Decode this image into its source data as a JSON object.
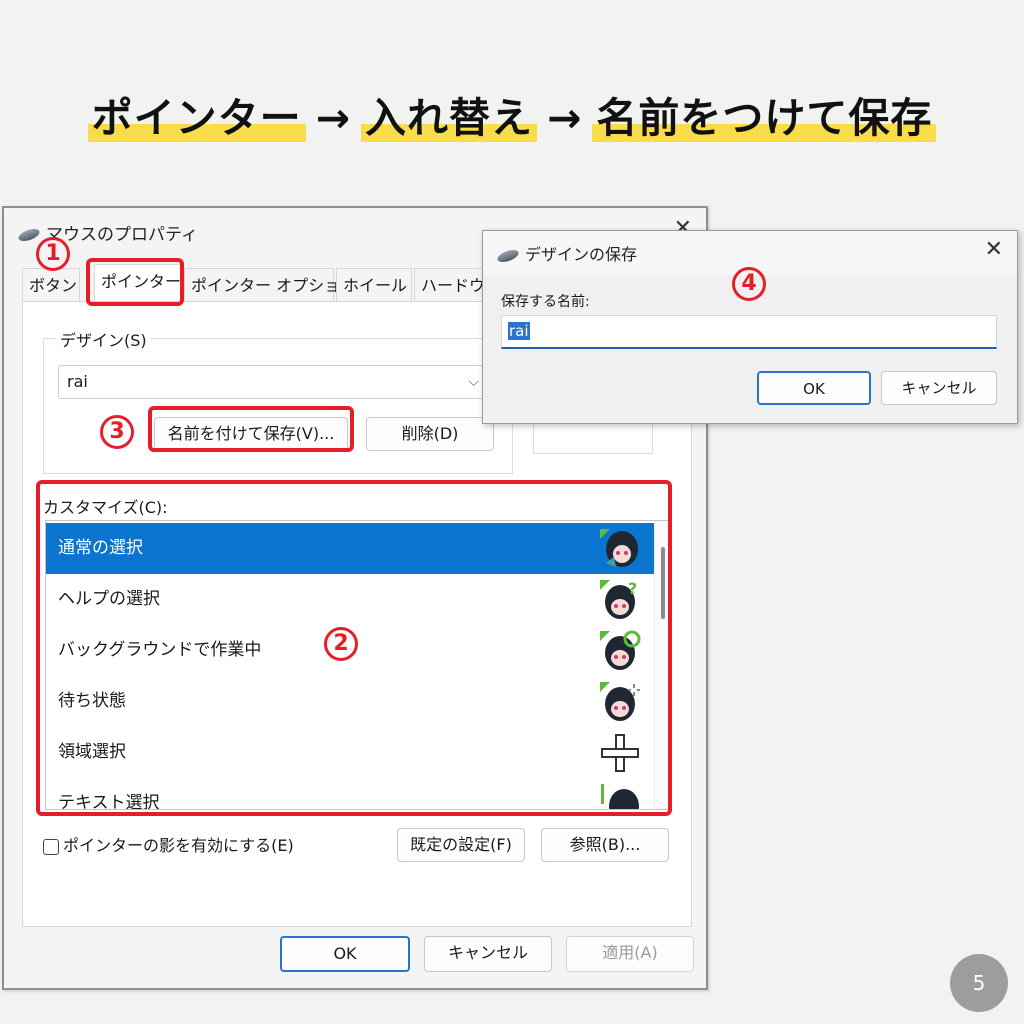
{
  "heading": {
    "part1": "ポインター",
    "arrow1": "→",
    "part2": "入れ替え",
    "arrow2": "→",
    "part3": "名前をつけて保存"
  },
  "main_dialog": {
    "title": "マウスのプロパティ",
    "close": "✕",
    "tabs": [
      "ボタン",
      "ポインター",
      "ポインター オプション",
      "ホイール",
      "ハードウェア"
    ],
    "design_label": "デザイン(S)",
    "design_value": "rai",
    "save_as_button": "名前を付けて保存(V)...",
    "delete_button": "削除(D)",
    "customize_label": "カスタマイズ(C):",
    "list_items": [
      "通常の選択",
      "ヘルプの選択",
      "バックグラウンドで作業中",
      "待ち状態",
      "領域選択",
      "テキスト選択"
    ],
    "shadow_checkbox": "ポインターの影を有効にする(E)",
    "default_button": "既定の設定(F)",
    "browse_button": "参照(B)...",
    "ok_button": "OK",
    "cancel_button": "キャンセル",
    "apply_button": "適用(A)"
  },
  "save_dialog": {
    "title": "デザインの保存",
    "close": "✕",
    "label": "保存する名前:",
    "input_value": "rai",
    "ok_button": "OK",
    "cancel_button": "キャンセル"
  },
  "annotations": {
    "step1": "1",
    "step2": "2",
    "step3": "3",
    "step4": "4"
  },
  "page_number": "5",
  "colors": {
    "highlight": "#f9dc4a",
    "annotation_red": "#e61e2a",
    "selection_blue": "#0a74cf"
  }
}
